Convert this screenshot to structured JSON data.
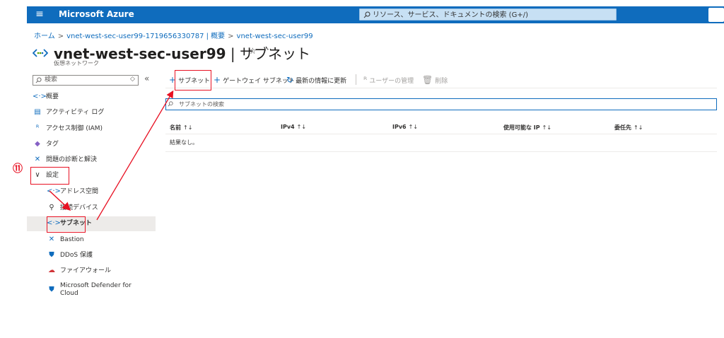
{
  "topbar": {
    "brand": "Microsoft Azure",
    "search_placeholder": "リソース、サービス、ドキュメントの検索 (G+/)"
  },
  "breadcrumb": [
    "ホーム",
    "vnet-west-sec-user99-1719656330787 | 概要",
    "vnet-west-sec-user99"
  ],
  "page": {
    "title_name": "vnet-west-sec-user99",
    "title_sep": " | ",
    "title_section": "サブネット",
    "subtitle": "仮想ネットワーク"
  },
  "sidebar": {
    "search_placeholder": "検索",
    "items": [
      {
        "label": "概要",
        "icon": "vnet-icon"
      },
      {
        "label": "アクティビティ ログ",
        "icon": "activity-log-icon"
      },
      {
        "label": "アクセス制御 (IAM)",
        "icon": "iam-icon"
      },
      {
        "label": "タグ",
        "icon": "tag-icon"
      },
      {
        "label": "問題の診断と解決",
        "icon": "diagnose-icon"
      },
      {
        "label": "設定",
        "icon": "chevron-down-icon"
      },
      {
        "label": "アドレス空間",
        "icon": "address-space-icon"
      },
      {
        "label": "接続デバイス",
        "icon": "plug-icon"
      },
      {
        "label": "サブネット",
        "icon": "vnet-icon"
      },
      {
        "label": "Bastion",
        "icon": "bastion-icon"
      },
      {
        "label": "DDoS 保護",
        "icon": "shield-icon"
      },
      {
        "label": "ファイアウォール",
        "icon": "firewall-icon"
      },
      {
        "label": "Microsoft Defender for",
        "label2": "Cloud",
        "icon": "defender-icon"
      }
    ]
  },
  "toolbar": {
    "add_subnet": "サブネット",
    "gateway_subnet": "ゲートウェイ サブネット",
    "refresh": "最新の情報に更新",
    "manage_users": "ユーザーの管理",
    "delete": "削除"
  },
  "subnet_search_placeholder": "サブネットの検索",
  "table": {
    "columns": [
      "名前",
      "IPv4",
      "IPv6",
      "使用可能な IP",
      "委任先"
    ],
    "sort_glyph": "↑↓",
    "empty": "結果なし。"
  },
  "annotation": {
    "step": "⑪"
  },
  "colors": {
    "accent": "#0f6cbd",
    "annotation": "#e81123"
  }
}
